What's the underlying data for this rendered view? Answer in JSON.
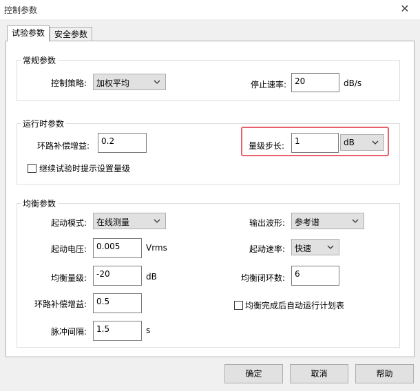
{
  "window": {
    "title": "控制参数",
    "close_glyph": "✕"
  },
  "tabs": [
    {
      "label": "试验参数",
      "active": true
    },
    {
      "label": "安全参数",
      "active": false
    }
  ],
  "general": {
    "title": "常规参数",
    "control_strategy_label": "控制策略:",
    "control_strategy_value": "加权平均",
    "stop_rate_label": "停止速率:",
    "stop_rate_value": "20",
    "stop_rate_unit": "dB/s"
  },
  "runtime": {
    "title": "运行时参数",
    "loop_gain_label": "环路补偿增益:",
    "loop_gain_value": "0.2",
    "level_step_label": "量级步长:",
    "level_step_value": "1",
    "level_step_unit": "dB",
    "prompt_checkbox_label": "继续试验时提示设置量级",
    "prompt_checked": false
  },
  "equalization": {
    "title": "均衡参数",
    "start_mode_label": "起动模式:",
    "start_mode_value": "在线测量",
    "output_waveform_label": "输出波形:",
    "output_waveform_value": "参考谱",
    "start_voltage_label": "起动电压:",
    "start_voltage_value": "0.005",
    "start_voltage_unit": "Vrms",
    "start_rate_label": "起动速率:",
    "start_rate_value": "快速",
    "eq_level_label": "均衡量级:",
    "eq_level_value": "-20",
    "eq_level_unit": "dB",
    "eq_loops_label": "均衡闭环数:",
    "eq_loops_value": "6",
    "loop_gain_label": "环路补偿增益:",
    "loop_gain_value": "0.5",
    "auto_run_label": "均衡完成后自动运行计划表",
    "auto_run_checked": false,
    "pulse_interval_label": "脉冲间隔:",
    "pulse_interval_value": "1.5",
    "pulse_interval_unit": "s"
  },
  "buttons": {
    "ok": "确定",
    "cancel": "取消",
    "help": "帮助"
  },
  "colors": {
    "highlight": "#e8606a",
    "background": "#f0f0f0"
  }
}
